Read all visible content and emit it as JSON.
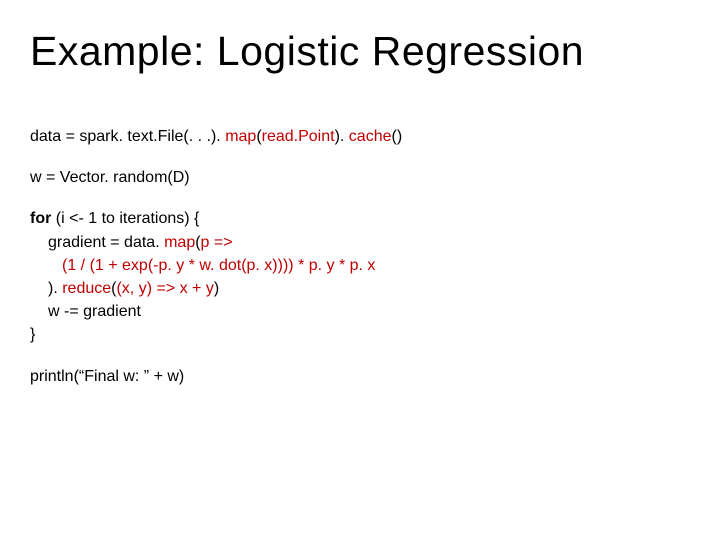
{
  "title": "Example: Logistic Regression",
  "code": {
    "l1a": "data = spark. text.File(. . .). ",
    "l1b": "map",
    "l1c": "(",
    "l1d": "read.Point",
    "l1e": "). ",
    "l1f": "cache",
    "l1g": "()",
    "l2": "w = Vector. random(D)",
    "l3a": "for",
    "l3b": " (i <- 1 to iterations) {",
    "l4a": "gradient = data. ",
    "l4b": "map",
    "l4c": "(",
    "l4d": "p =>",
    "l5": "(1 / (1 + exp(-p. y * w. dot(p. x)))) * p. y * p. x",
    "l6a": "). ",
    "l6b": "reduce",
    "l6c": "(",
    "l6d": "(x, y) => x + y",
    "l6e": ")",
    "l7": "w -= gradient",
    "l8": "}",
    "l9": "println(“Final w: ” + w)"
  }
}
